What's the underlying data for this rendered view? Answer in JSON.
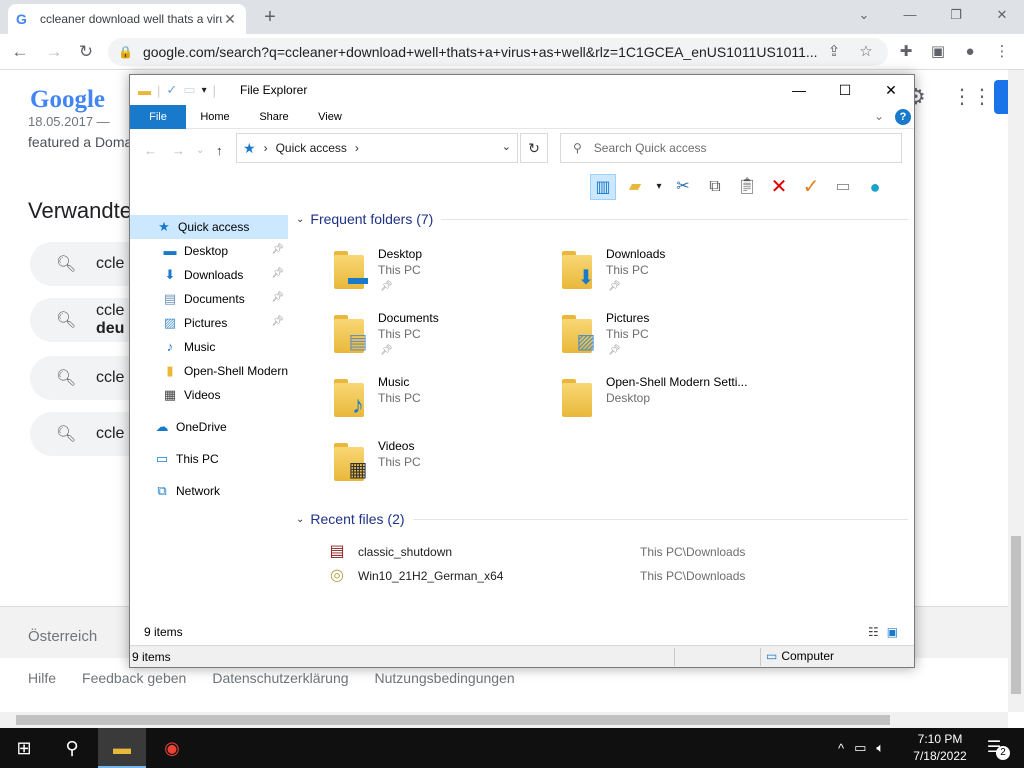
{
  "browser": {
    "tab_title": "ccleaner download well thats a virus as well",
    "tab_favicon": "G",
    "url": "google.com/search?q=ccleaner+download+well+thats+a+virus+as+well&rlz=1C1GCEA_enUS1011US1011...",
    "accent": "#4285f4"
  },
  "google": {
    "logo": "Google",
    "snippet_date": "18.05.2017 —",
    "snippet_text": "featured a Doma",
    "related_title": "Verwandte",
    "related": [
      {
        "line1": "ccle",
        "line2": ""
      },
      {
        "line1": "ccle",
        "line2": "deu"
      },
      {
        "line1": "ccle",
        "line2": ""
      },
      {
        "line1": "ccle",
        "line2": ""
      }
    ],
    "footer_country": "Österreich",
    "footer_links": [
      "Hilfe",
      "Feedback geben",
      "Datenschutzerklärung",
      "Nutzungsbedingungen"
    ]
  },
  "explorer": {
    "title": "File Explorer",
    "ribbon_tabs": [
      "File",
      "Home",
      "Share",
      "View"
    ],
    "address": "Quick access",
    "search_placeholder": "Search Quick access",
    "nav": [
      {
        "label": "Quick access",
        "icon": "star-icon",
        "pinned": false,
        "selected": true,
        "indent": 1
      },
      {
        "label": "Desktop",
        "icon": "desktop-icon",
        "pinned": true,
        "indent": 2
      },
      {
        "label": "Downloads",
        "icon": "download-icon",
        "pinned": true,
        "indent": 2
      },
      {
        "label": "Documents",
        "icon": "document-icon",
        "pinned": true,
        "indent": 2
      },
      {
        "label": "Pictures",
        "icon": "picture-icon",
        "pinned": true,
        "indent": 2
      },
      {
        "label": "Music",
        "icon": "music-icon",
        "pinned": false,
        "indent": 2
      },
      {
        "label": "Open-Shell Modern",
        "icon": "folder-icon",
        "pinned": false,
        "indent": 2
      },
      {
        "label": "Videos",
        "icon": "video-icon",
        "pinned": false,
        "indent": 2
      },
      {
        "label": "OneDrive",
        "icon": "cloud-icon",
        "pinned": false,
        "indent": 1
      },
      {
        "label": "This PC",
        "icon": "computer-icon",
        "pinned": false,
        "indent": 1
      },
      {
        "label": "Network",
        "icon": "network-icon",
        "pinned": false,
        "indent": 1
      }
    ],
    "frequent_header": "Frequent folders (7)",
    "frequent": [
      {
        "name": "Desktop",
        "location": "This PC",
        "pinned": true,
        "overlay": "desktop-icon"
      },
      {
        "name": "Downloads",
        "location": "This PC",
        "pinned": true,
        "overlay": "download-icon"
      },
      {
        "name": "Documents",
        "location": "This PC",
        "pinned": true,
        "overlay": "document-icon"
      },
      {
        "name": "Pictures",
        "location": "This PC",
        "pinned": true,
        "overlay": "picture-icon"
      },
      {
        "name": "Music",
        "location": "This PC",
        "pinned": false,
        "overlay": "music-icon"
      },
      {
        "name": "Open-Shell Modern Setti...",
        "location": "Desktop",
        "pinned": false,
        "overlay": ""
      },
      {
        "name": "Videos",
        "location": "This PC",
        "pinned": false,
        "overlay": "video-icon"
      }
    ],
    "recent_header": "Recent files (2)",
    "recent": [
      {
        "name": "classic_shutdown",
        "path": "This PC\\Downloads",
        "icon": "archive-icon"
      },
      {
        "name": "Win10_21H2_German_x64",
        "path": "This PC\\Downloads",
        "icon": "disc-icon"
      }
    ],
    "status_count": "9 items",
    "statusbar_count": "9 items",
    "statusbar_location": "Computer"
  },
  "taskbar": {
    "time": "7:10 PM",
    "date": "7/18/2022",
    "notifications": "2"
  }
}
